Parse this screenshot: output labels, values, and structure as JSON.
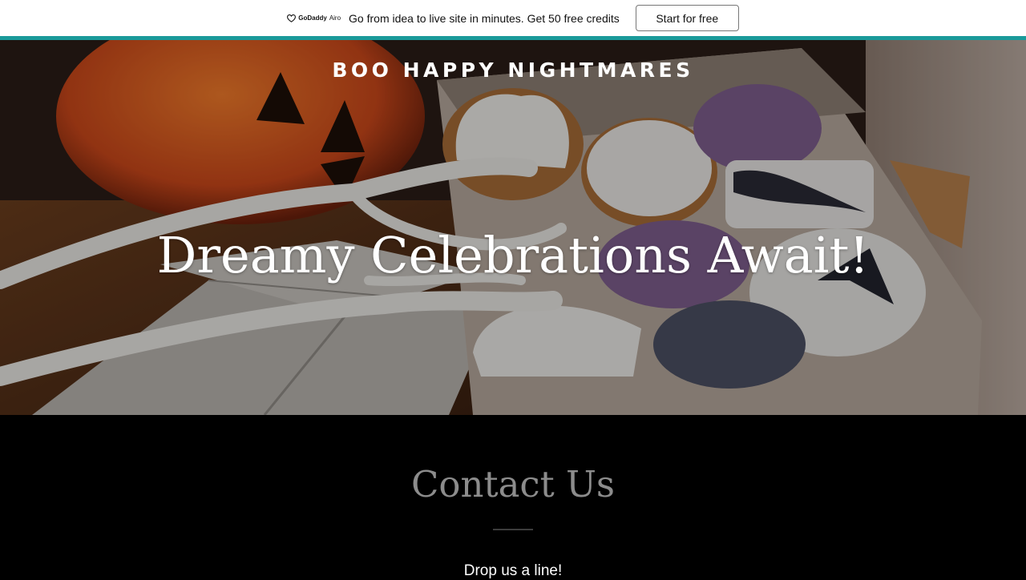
{
  "promo": {
    "brand": "GoDaddy",
    "product": "Airo",
    "message": "Go from idea to live site in minutes. Get 50 free credits",
    "cta_label": "Start for free"
  },
  "hero": {
    "site_title": "BOO HAPPY NIGHTMARES",
    "heading": "Dreamy Celebrations Await!"
  },
  "contact": {
    "title": "Contact Us",
    "subtitle": "Drop us a line!"
  },
  "colors": {
    "accent": "#1a9a9a",
    "background": "#000000",
    "contact_title": "#8c8c8c"
  }
}
